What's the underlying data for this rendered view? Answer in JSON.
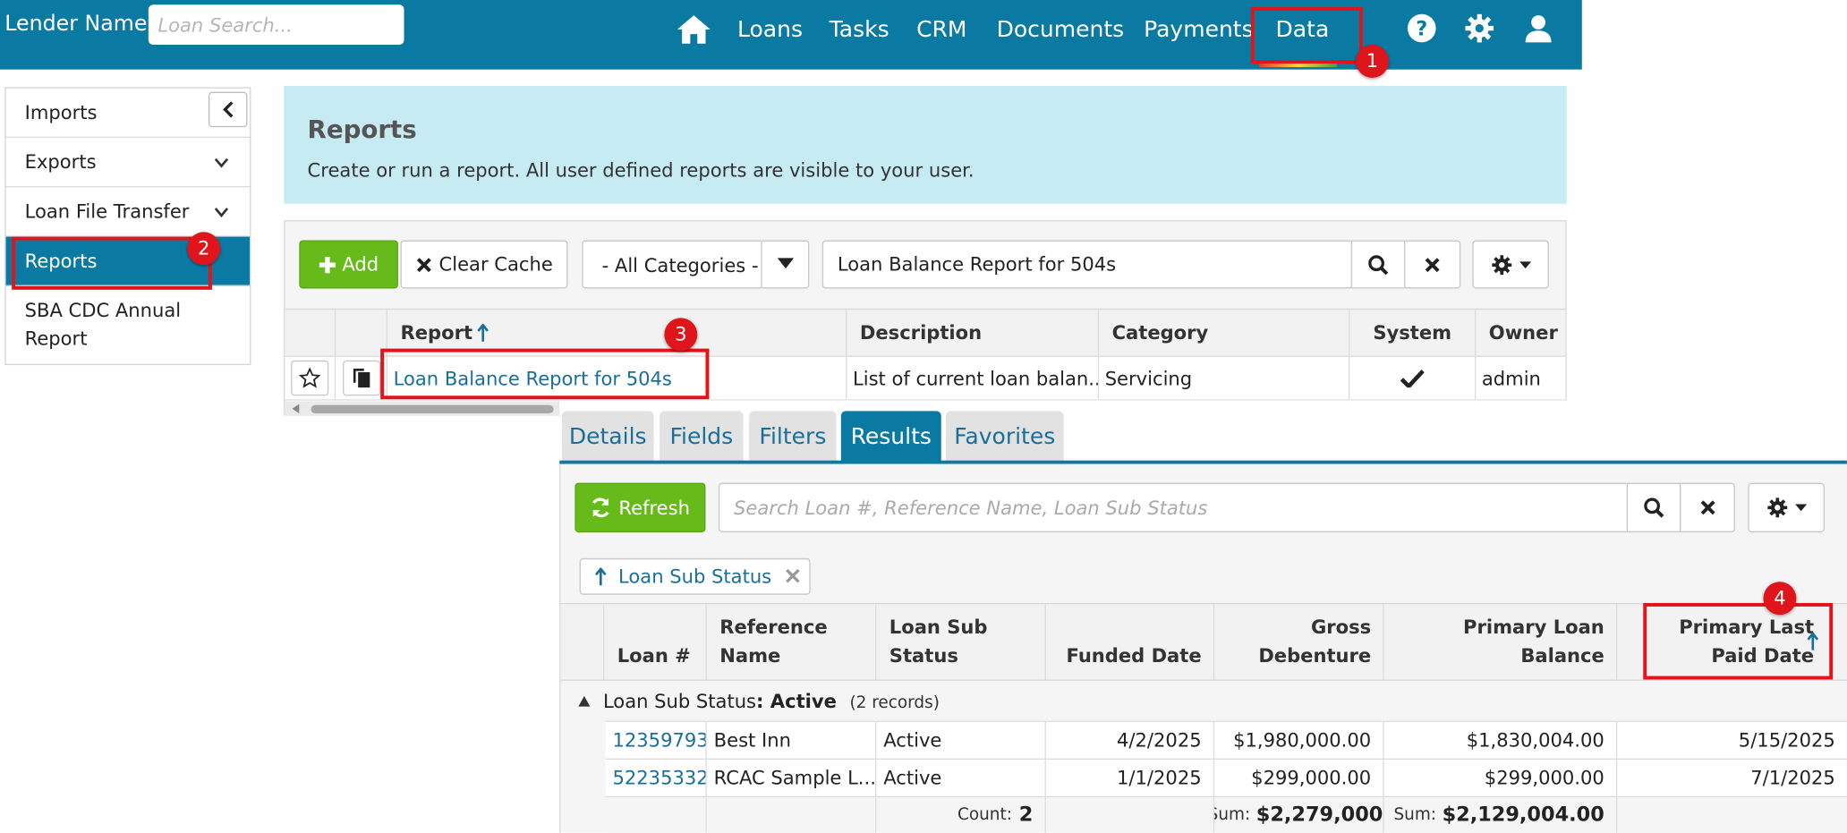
{
  "navbar": {
    "brand": "Lender Name",
    "search_placeholder": "Loan Search...",
    "links": [
      "Loans",
      "Tasks",
      "CRM",
      "Documents",
      "Payments",
      "Data"
    ]
  },
  "callouts": [
    "1",
    "2",
    "3",
    "4"
  ],
  "sidebar": {
    "items": [
      "Imports",
      "Exports",
      "Loan File Transfer",
      "Reports",
      "SBA CDC Annual",
      "Report"
    ]
  },
  "reports_panel": {
    "title": "Reports",
    "description": "Create or run a report. All user defined reports are visible to your user."
  },
  "toolbar": {
    "add_label": "Add",
    "clear_cache_label": "Clear Cache",
    "category_selected": "- All Categories -",
    "search_value": "Loan Balance Report for 504s"
  },
  "reports_table": {
    "headers": [
      "Report",
      "Description",
      "Category",
      "System",
      "Owner"
    ],
    "row": {
      "report": "Loan Balance Report for 504s",
      "description": "List of current loan balan...",
      "category": "Servicing",
      "owner": "admin"
    }
  },
  "tabs": [
    "Details",
    "Fields",
    "Filters",
    "Results",
    "Favorites"
  ],
  "results": {
    "refresh_label": "Refresh",
    "search_placeholder": "Search Loan #, Reference Name, Loan Sub Status",
    "filter_chip": "Loan Sub Status",
    "headers": {
      "loan": "Loan #",
      "reference": [
        "Reference",
        "Name"
      ],
      "substatus": [
        "Loan Sub",
        "Status"
      ],
      "funded": "Funded Date",
      "gross": [
        "Gross",
        "Debenture"
      ],
      "balance": [
        "Primary Loan",
        "Balance"
      ],
      "lastpaid": [
        "Primary Last",
        "Paid Date"
      ]
    },
    "group": {
      "label": "Loan Sub Status",
      "value": "Active",
      "count_text": "(2 records)"
    },
    "rows": [
      {
        "loan": "12359793",
        "reference": "Best Inn",
        "substatus": "Active",
        "funded": "4/2/2025",
        "gross": "$1,980,000.00",
        "balance": "$1,830,004.00",
        "lastpaid": "5/15/2025"
      },
      {
        "loan": "52235332",
        "reference": "RCAC Sample L...",
        "substatus": "Active",
        "funded": "1/1/2025",
        "gross": "$299,000.00",
        "balance": "$299,000.00",
        "lastpaid": "7/1/2025"
      }
    ],
    "summary": {
      "count_label": "Count:",
      "count_value": "2",
      "sum_label": "Sum:",
      "gross_sum": "$2,279,000",
      "balance_sum": "$2,129,004.00"
    }
  }
}
